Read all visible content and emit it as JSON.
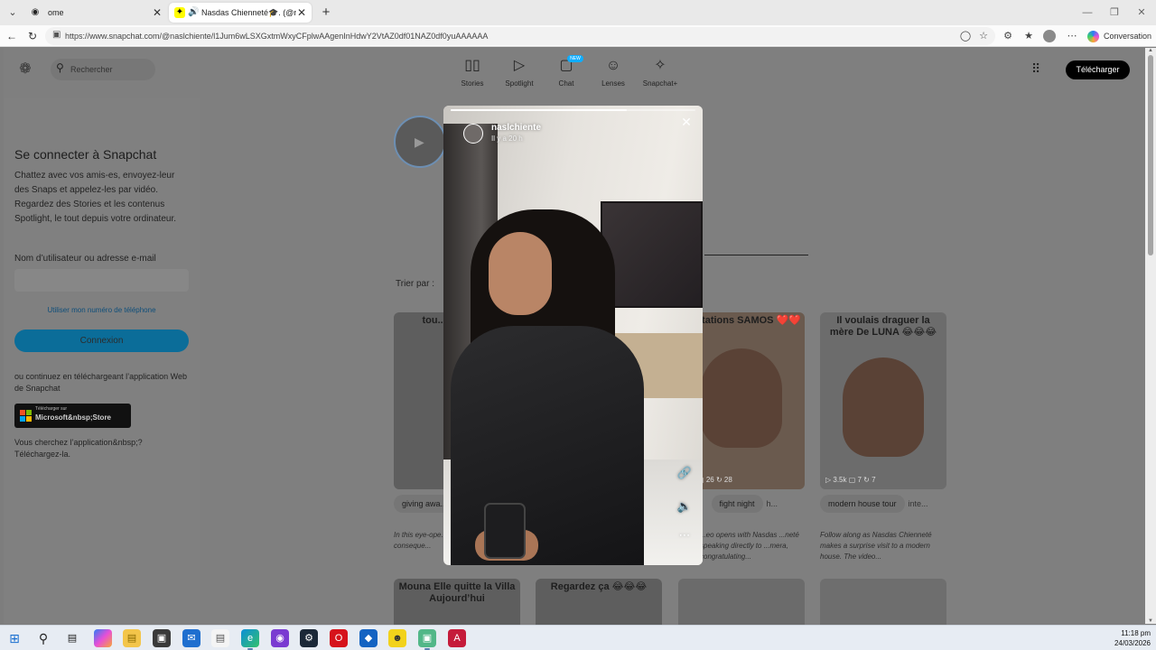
{
  "browser": {
    "tabs": [
      {
        "title": "ome",
        "active": false
      },
      {
        "title": "Nasdas Chienneté🎓. (@nasl",
        "active": true
      }
    ],
    "new_tab": "+",
    "url": "https://www.snapchat.com/@naslchiente/l1Jum6wLSXGxtmWxyCFplwAAgenInHdwY2VtAZ0df01NAZ0df0yuAAAAAA",
    "copilot_label": "Conversation"
  },
  "nav": {
    "search_placeholder": "Rechercher",
    "items": [
      {
        "label": "Stories",
        "icon": "stories-icon",
        "glyph": "▯▯"
      },
      {
        "label": "Spotlight",
        "icon": "spotlight-icon",
        "glyph": "▷"
      },
      {
        "label": "Chat",
        "icon": "chat-icon",
        "glyph": "▢"
      },
      {
        "label": "Lenses",
        "icon": "lenses-icon",
        "glyph": "☺"
      },
      {
        "label": "Snapchat+",
        "icon": "snapchat-plus-icon",
        "glyph": "✧"
      }
    ],
    "chat_badge": "NEW",
    "download_label": "Télécharger"
  },
  "login": {
    "title": "Se connecter à Snapchat",
    "description": "Chattez avec vos amis-es, envoyez-leur des Snaps et appelez-les par vidéo. Regardez des Stories et les contenus Spotlight, le tout depuis votre ordinateur.",
    "username_label": "Nom d’utilisateur ou adresse e-mail",
    "phone_link": "Utiliser mon numéro de téléphone",
    "connect_label": "Connexion",
    "or_text": "ou continuez en téléchargeant l’application Web de Snapchat",
    "store_small": "Télécharger sur",
    "store_big": "Microsoft&nbsp;Store",
    "looking_line1": "Vous cherchez l’application&nbsp;?",
    "looking_line2": "Téléchargez-la."
  },
  "profile": {
    "sort_label": "Trier par :"
  },
  "cards_row1": [
    {
      "caption": "tou... malheu...",
      "stats": "",
      "desc": "In this eye-ope... experiment, th... the conseque..."
    },
    {
      "caption": "plicitations SAMOS ❤️❤️",
      "stats": "▷ .. ▢ 26 ↻ 28",
      "desc": "...eo opens with Nasdas ...neté speaking directly to ...mera, congratulating..."
    },
    {
      "caption": "Il voulais draguer la mère De LUNA 😂😂😂",
      "stats": "▷ 3.5k ▢ 7 ↻ 7",
      "desc": "Follow along as Nasdas Chienneté makes a surprise visit to a modern house. The video..."
    }
  ],
  "tags_row1": [
    [
      "giving awa..."
    ],
    [
      "...OS",
      "fight night",
      "h..."
    ],
    [
      "modern house tour",
      "inte..."
    ]
  ],
  "cards_row2": [
    {
      "caption": "Mouna Elle quitte la Villa Aujourd’hui"
    },
    {
      "caption": "Regardez ça 😂😂😂"
    },
    {
      "caption": ""
    },
    {
      "caption": ""
    }
  ],
  "story": {
    "username": "naslchiente",
    "time": "Il y a 20 h",
    "progress": 0.72
  },
  "clock": {
    "time": "11:18 pm",
    "date": "24/03/2026"
  }
}
